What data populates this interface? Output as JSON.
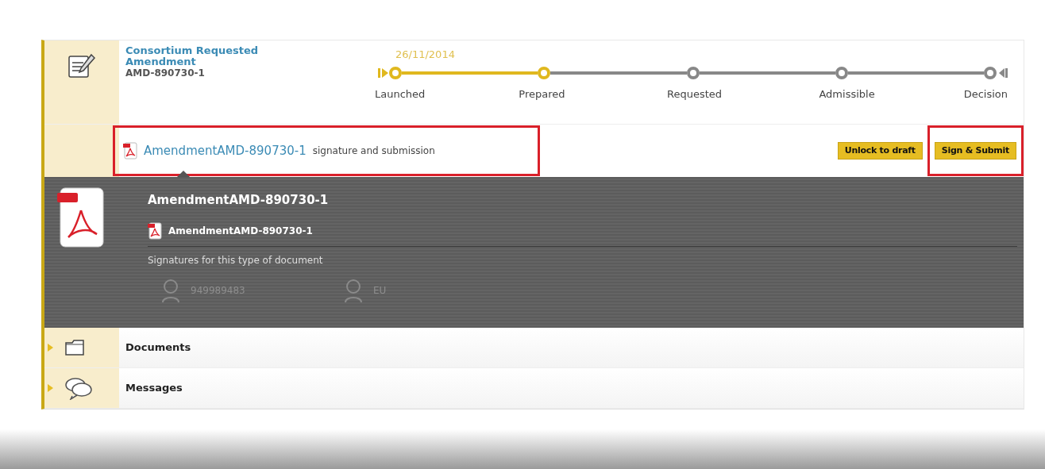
{
  "header": {
    "title": "Consortium Requested Amendment",
    "code": "AMD-890730-1",
    "date": "26/11/2014",
    "steps": [
      {
        "label": "Launched",
        "done": true
      },
      {
        "label": "Prepared",
        "done": true
      },
      {
        "label": "Requested",
        "done": false
      },
      {
        "label": "Admissible",
        "done": false
      },
      {
        "label": "Decision",
        "done": false
      }
    ]
  },
  "action_row": {
    "link": "AmendmentAMD-890730-1",
    "note": "signature and submission",
    "buttons": [
      {
        "label": "Unlock to draft",
        "highlighted": false
      },
      {
        "label": "Sign & Submit",
        "highlighted": true
      }
    ]
  },
  "document_panel": {
    "title": "AmendmentAMD-890730-1",
    "file": "AmendmentAMD-890730-1",
    "signatures_label": "Signatures for this type of document",
    "signers": [
      {
        "label": "949989483"
      },
      {
        "label": "EU"
      }
    ]
  },
  "sections": [
    {
      "label": "Documents",
      "kind": "folder",
      "expanded": false
    },
    {
      "label": "Messages",
      "kind": "messages",
      "expanded": false
    }
  ]
}
